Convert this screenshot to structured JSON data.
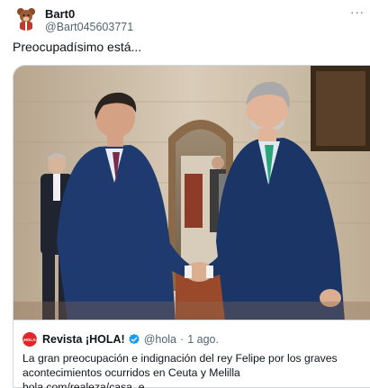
{
  "tweet": {
    "author": {
      "display_name": "Bart0",
      "handle": "@Bart045603771",
      "avatar_icon": "teddy-bear-avatar-icon"
    },
    "more_icon": "ellipsis-horizontal-icon",
    "more_label": "···",
    "text": "Preocupadísimo está...",
    "media": {
      "type": "photo",
      "icon": "photo-handshake-image"
    }
  },
  "quote": {
    "avatar_text": "¡HOLA!",
    "author_name": "Revista ¡HOLA!",
    "verified_icon": "verified-badge-icon",
    "handle": "@hola",
    "separator": "·",
    "time": "1 ago.",
    "body": "La gran preocupación e indignación del rey Felipe por los graves acontecimientos ocurridos en Ceuta y Melilla ",
    "link": "hola.com/realeza/casa_e…"
  },
  "colors": {
    "text_primary": "#0f1419",
    "text_secondary": "#536471",
    "border": "#cfd9de",
    "verified_blue": "#1d9bf0",
    "hola_red": "#e3262c"
  }
}
